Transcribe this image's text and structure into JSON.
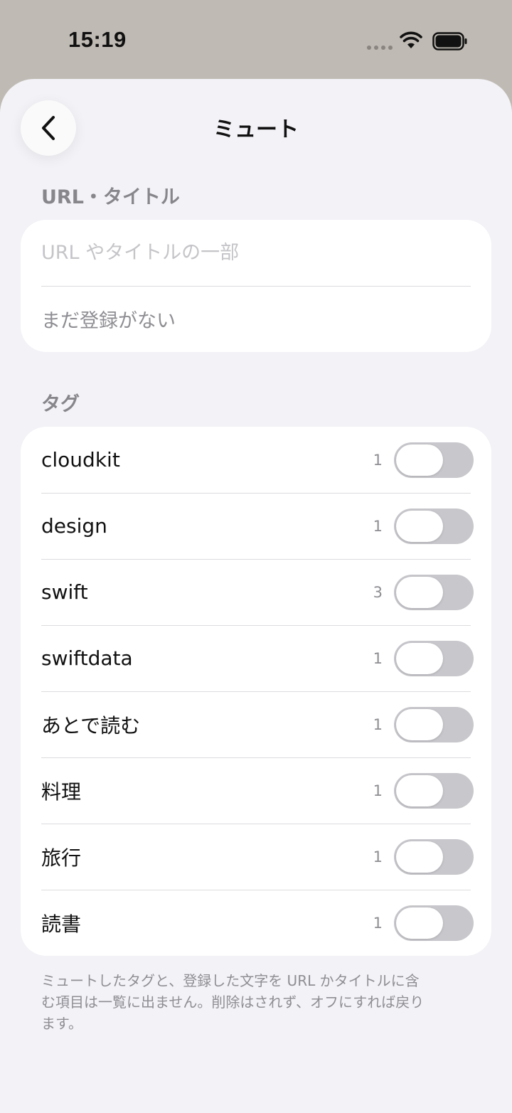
{
  "status_bar": {
    "time": "15:19"
  },
  "nav": {
    "title": "ミュート"
  },
  "url_section": {
    "header": "URL・タイトル",
    "placeholder": "URL やタイトルの一部",
    "empty_text": "まだ登録がない"
  },
  "tags_section": {
    "header": "タグ",
    "items": [
      {
        "label": "cloudkit",
        "count": "1",
        "muted": false
      },
      {
        "label": "design",
        "count": "1",
        "muted": false
      },
      {
        "label": "swift",
        "count": "3",
        "muted": false
      },
      {
        "label": "swiftdata",
        "count": "1",
        "muted": false
      },
      {
        "label": "あとで読む",
        "count": "1",
        "muted": false
      },
      {
        "label": "料理",
        "count": "1",
        "muted": false
      },
      {
        "label": "旅行",
        "count": "1",
        "muted": false
      },
      {
        "label": "読書",
        "count": "1",
        "muted": false
      }
    ]
  },
  "footer": {
    "note": "ミュートしたタグと、登録した文字を URL かタイトルに含む項目は一覧に出ません。削除はされず、オフにすれば戻ります。"
  },
  "colors": {
    "background": "#f2f2f7",
    "toggle_off": "#c7c7cc",
    "secondary_text": "#8e8e93"
  }
}
